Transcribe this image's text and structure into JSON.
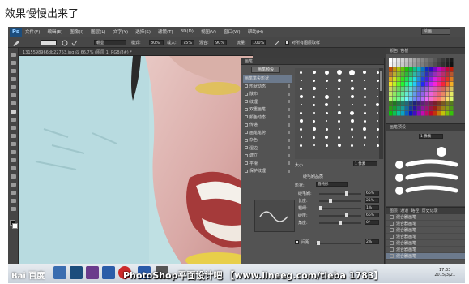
{
  "caption": "效果慢慢出来了",
  "app": {
    "logo": "Ps",
    "menus": [
      "文件(F)",
      "编辑(E)",
      "图像(I)",
      "图层(L)",
      "文字(Y)",
      "选择(S)",
      "滤镜(T)",
      "3D(D)",
      "视图(V)",
      "窗口(W)",
      "帮助(H)"
    ],
    "workspace": "绘画"
  },
  "options": {
    "mode_label": "模式:",
    "mode_value": "正常",
    "opacity_label": "不透明度:",
    "opacity_value": "80%",
    "flow_label": "流量:",
    "flow_value": "75%",
    "wet_value": "潮湿",
    "wet_pct": "80%",
    "load_label": "载入:",
    "load_value": "75%",
    "mix_label": "混合:",
    "mix_value": "90%",
    "flow2_label": "流量:",
    "flow2_value": "100%",
    "sample_label": "对所有图层取样"
  },
  "document": {
    "tab": "1315598966db22753.jpg @ 66.7% (图层 1, RGB/8#) *"
  },
  "brush_panel": {
    "tabs": [
      "画笔",
      "画笔预设"
    ],
    "preset_button": "画笔预设",
    "items": [
      {
        "label": "画笔笔尖形状",
        "selected": true
      },
      {
        "label": "形状动态",
        "selected": false
      },
      {
        "label": "散布",
        "selected": false
      },
      {
        "label": "纹理",
        "selected": false
      },
      {
        "label": "双重画笔",
        "selected": false
      },
      {
        "label": "颜色动态",
        "selected": false
      },
      {
        "label": "传递",
        "selected": false
      },
      {
        "label": "画笔笔势",
        "selected": false
      },
      {
        "label": "杂色",
        "selected": false
      },
      {
        "label": "湿边",
        "selected": false
      },
      {
        "label": "建立",
        "selected": false
      },
      {
        "label": "平滑",
        "selected": false
      },
      {
        "label": "保护纹理",
        "selected": false
      }
    ],
    "size_label": "大小",
    "size_value": "1 像素",
    "bristle_title": "硬毛刷品质",
    "shape_label": "形状:",
    "shape_value": "圆钝形",
    "params": [
      {
        "label": "硬毛刷:",
        "value": "66%",
        "pos": 0.66
      },
      {
        "label": "长度:",
        "value": "25%",
        "pos": 0.25
      },
      {
        "label": "粗细:",
        "value": "1%",
        "pos": 0.01
      },
      {
        "label": "硬度:",
        "value": "66%",
        "pos": 0.66
      },
      {
        "label": "角度:",
        "value": "0°",
        "pos": 0.5
      }
    ],
    "spacing_label": "间距",
    "spacing_value": "2%"
  },
  "swatches_panel": {
    "tabs": [
      "颜色",
      "色板"
    ]
  },
  "brush_presets_panel": {
    "tabs": [
      "画笔预设"
    ],
    "size_value": "1 像素"
  },
  "history_panel": {
    "tabs": [
      "图层",
      "通道",
      "路径",
      "历史记录"
    ],
    "rows": [
      {
        "label": "混合器画笔",
        "selected": false
      },
      {
        "label": "混合器画笔",
        "selected": false
      },
      {
        "label": "混合器画笔",
        "selected": false
      },
      {
        "label": "混合器画笔",
        "selected": false
      },
      {
        "label": "混合器画笔",
        "selected": false
      },
      {
        "label": "混合器画笔",
        "selected": false
      },
      {
        "label": "混合器画笔",
        "selected": true
      }
    ]
  },
  "taskbar": {
    "watermark": "PhotoShop平面设计吧 【www.lineeg.com/tieba 1783】",
    "baidu": "Bai 百度",
    "time": "17:33",
    "date": "2015/3/21"
  },
  "colors": {
    "accent": "#6c7a8d",
    "panel": "#535353",
    "dark": "#3c3c3c"
  }
}
